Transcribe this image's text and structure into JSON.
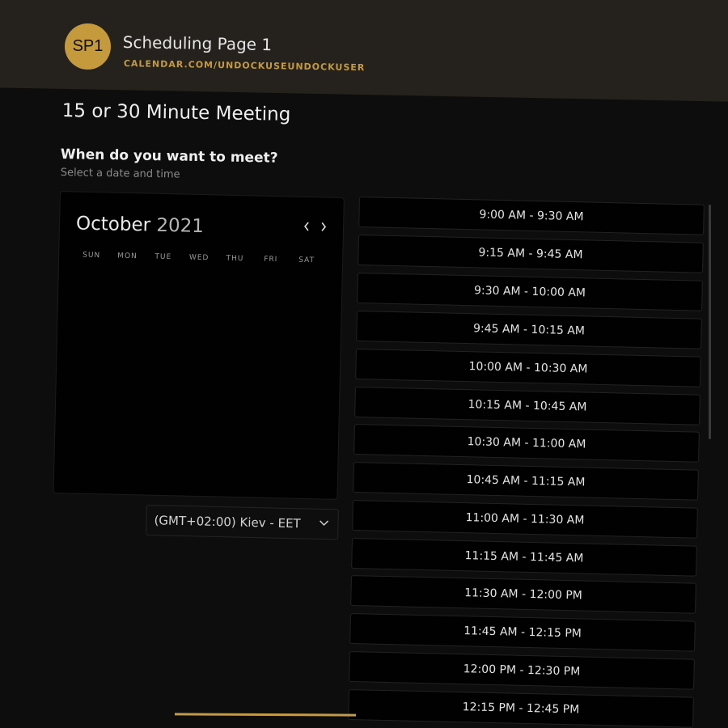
{
  "header": {
    "avatar_initials": "SP1",
    "title": "Scheduling Page 1",
    "url": "CALENDAR.COM/UNDOCKUSEUNDOCKUSER"
  },
  "meeting": {
    "title": "15 or 30 Minute Meeting",
    "question": "When do you want to meet?",
    "instruction": "Select a date and time"
  },
  "calendar": {
    "month": "October",
    "year": "2021",
    "prev_icon": "chevron-left-icon",
    "next_icon": "chevron-right-icon",
    "weekdays": [
      "SUN",
      "MON",
      "TUE",
      "WED",
      "THU",
      "FRI",
      "SAT"
    ]
  },
  "timezone": {
    "value": "(GMT+02:00) Kiev - EET",
    "icon": "chevron-down-icon"
  },
  "time_slots": [
    "9:00 AM - 9:30 AM",
    "9:15 AM - 9:45 AM",
    "9:30 AM - 10:00 AM",
    "9:45 AM - 10:15 AM",
    "10:00 AM - 10:30 AM",
    "10:15 AM - 10:45 AM",
    "10:30 AM - 11:00 AM",
    "10:45 AM - 11:15 AM",
    "11:00 AM - 11:30 AM",
    "11:15 AM - 11:45 AM",
    "11:30 AM - 12:00 PM",
    "11:45 AM - 12:15 PM",
    "12:00 PM - 12:30 PM",
    "12:15 PM - 12:45 PM"
  ],
  "colors": {
    "accent": "#c59a3c",
    "background": "#0d0d0d",
    "header": "#25221d"
  }
}
